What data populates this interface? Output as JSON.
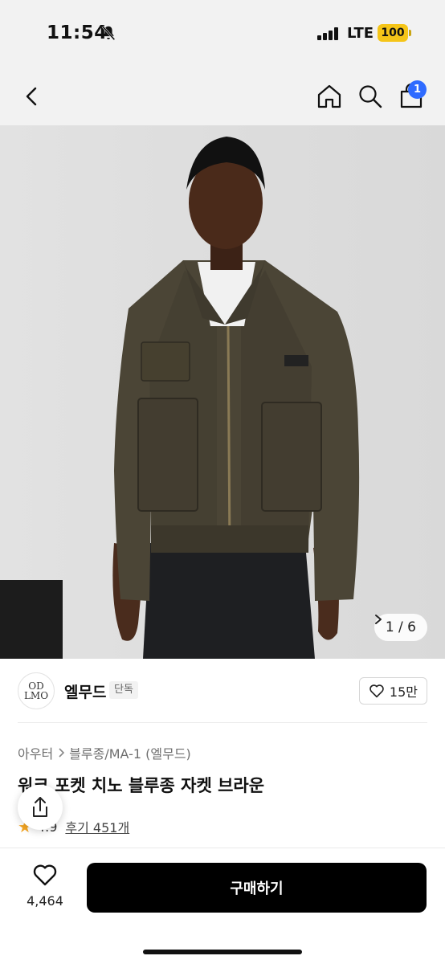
{
  "status_bar": {
    "time": "11:54",
    "network": "LTE",
    "battery": "100",
    "icons": [
      "bell-muted-icon",
      "signal-icon",
      "battery-icon"
    ]
  },
  "nav": {
    "icons": [
      "chevron-left-icon",
      "home-icon",
      "search-icon",
      "cart-icon"
    ],
    "cart_badge": "1"
  },
  "gallery": {
    "counter": "1 / 6",
    "counter_icon": "chevron-right-icon"
  },
  "brand": {
    "logo_text_top": "OD",
    "logo_text_bottom": "LMO",
    "name": "엘무드",
    "tag": "단독",
    "likes": "15만"
  },
  "product": {
    "breadcrumb": [
      "아우터",
      "블루종/MA-1 (엘무드)"
    ],
    "title": "워크 포켓 치노 블루종 자켓 브라운",
    "rating": "4.9",
    "reviews": "후기 451개"
  },
  "bottom": {
    "wish_count": "4,464",
    "buy_label": "구매하기"
  },
  "colors": {
    "accent": "#2f6bff",
    "battery": "#f5c518",
    "star": "#f5a623",
    "buy_button": "#000000"
  }
}
